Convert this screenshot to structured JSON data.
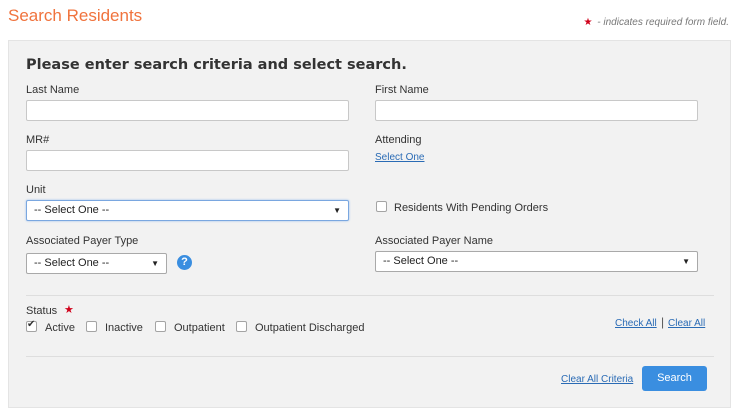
{
  "page": {
    "title": "Search Residents",
    "required_note": "- indicates required form field.",
    "required_star": "★"
  },
  "form": {
    "heading": "Please enter search criteria and select search.",
    "last_name": {
      "label": "Last Name",
      "value": ""
    },
    "first_name": {
      "label": "First Name",
      "value": ""
    },
    "mr": {
      "label": "MR#",
      "value": ""
    },
    "attending": {
      "label": "Attending",
      "link": "Select One"
    },
    "unit": {
      "label": "Unit",
      "selected": "-- Select One --"
    },
    "pending_orders": {
      "label": "Residents With Pending Orders",
      "checked": false
    },
    "payer_type": {
      "label": "Associated Payer Type",
      "selected": "-- Select One --",
      "help": "?"
    },
    "payer_name": {
      "label": "Associated Payer Name",
      "selected": "-- Select One --"
    },
    "status": {
      "label": "Status",
      "options": [
        {
          "label": "Active",
          "checked": true
        },
        {
          "label": "Inactive",
          "checked": false
        },
        {
          "label": "Outpatient",
          "checked": false
        },
        {
          "label": "Outpatient Discharged",
          "checked": false
        }
      ],
      "check_all": "Check All",
      "separator": "|",
      "clear_all": "Clear All"
    },
    "clear_all_criteria": "Clear All Criteria",
    "search_label": "Search"
  },
  "colors": {
    "title": "#f0733d",
    "accent": "#3a8ee0",
    "link": "#2a6bb5",
    "required": "#d0021b"
  }
}
